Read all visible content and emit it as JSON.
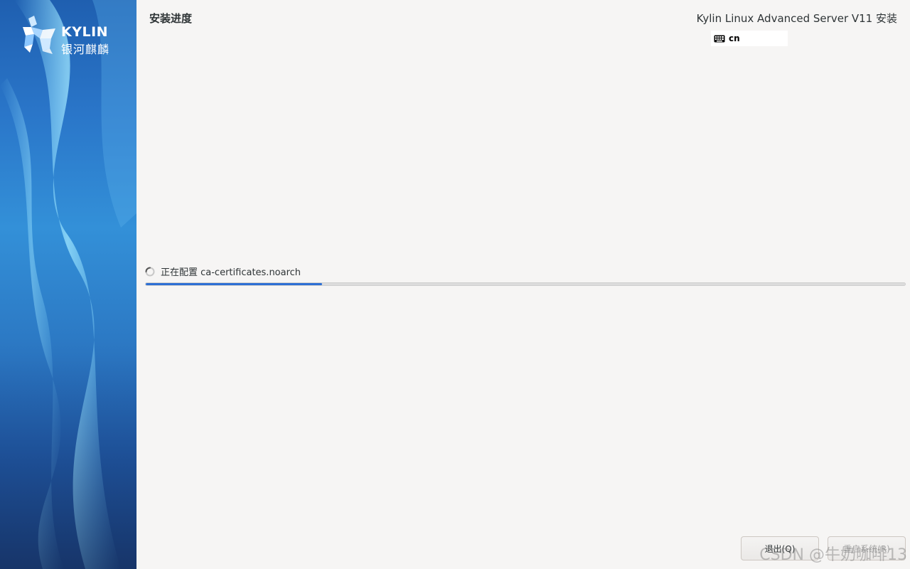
{
  "sidebar": {
    "logo_text": "KYLIN",
    "logo_cn": "银河麒麟"
  },
  "header": {
    "page_title": "安装进度",
    "product_title": "Kylin Linux Advanced Server V11 安装",
    "keyboard_layout": "cn"
  },
  "progress": {
    "status": "正在配置 ca-certificates.noarch",
    "percent": 23.2
  },
  "buttons": {
    "quit": "退出(Q)",
    "reboot": "重启系统(R)"
  },
  "watermark": "CSDN @牛奶咖啡13",
  "colors": {
    "accent": "#2d6fd4",
    "background": "#f6f5f4"
  }
}
